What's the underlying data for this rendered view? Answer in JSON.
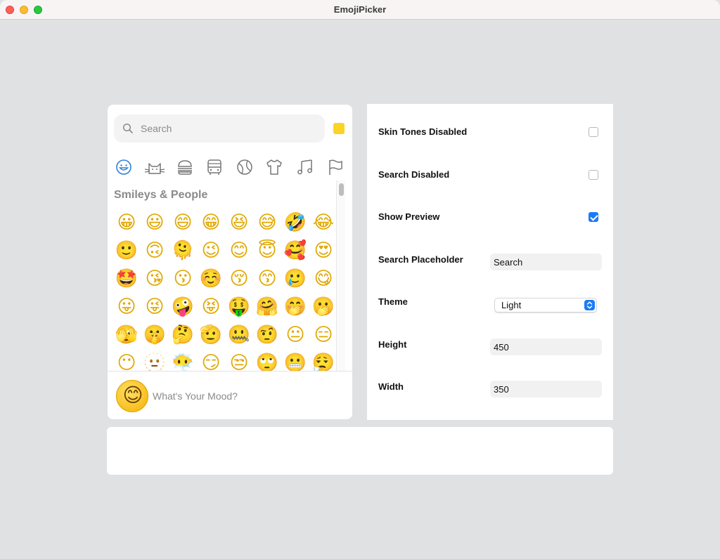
{
  "window": {
    "title": "EmojiPicker"
  },
  "picker": {
    "search_placeholder": "Search",
    "skin_tone_color": "#fcd327",
    "categories": [
      "smileys-icon",
      "animals-icon",
      "food-icon",
      "travel-icon",
      "activities-icon",
      "objects-icon",
      "symbols-icon",
      "flags-icon"
    ],
    "section_title": "Smileys & People",
    "emojis": [
      "😀",
      "😃",
      "😄",
      "😁",
      "😆",
      "😅",
      "🤣",
      "😂",
      "🙂",
      "🙃",
      "🫠",
      "😉",
      "😊",
      "😇",
      "🥰",
      "😍",
      "🤩",
      "😘",
      "😗",
      "☺️",
      "😚",
      "😙",
      "🥲",
      "😋",
      "😛",
      "😜",
      "🤪",
      "😝",
      "🤑",
      "🤗",
      "🤭",
      "🫢",
      "🫣",
      "🤫",
      "🤔",
      "🫡",
      "🤐",
      "🤨",
      "😐",
      "😑",
      "😶",
      "🫥",
      "😶‍🌫️",
      "😏",
      "😒",
      "🙄",
      "😬",
      "😮‍💨"
    ],
    "preview_emoji": "😊",
    "preview_text": "What's Your Mood?"
  },
  "settings": {
    "skin_tones_label": "Skin Tones Disabled",
    "skin_tones_checked": false,
    "search_disabled_label": "Search Disabled",
    "search_disabled_checked": false,
    "show_preview_label": "Show Preview",
    "show_preview_checked": true,
    "search_placeholder_label": "Search Placeholder",
    "search_placeholder_value": "Search",
    "theme_label": "Theme",
    "theme_value": "Light",
    "height_label": "Height",
    "height_value": "450",
    "width_label": "Width",
    "width_value": "350",
    "accent_color": "#1a7cf5"
  }
}
